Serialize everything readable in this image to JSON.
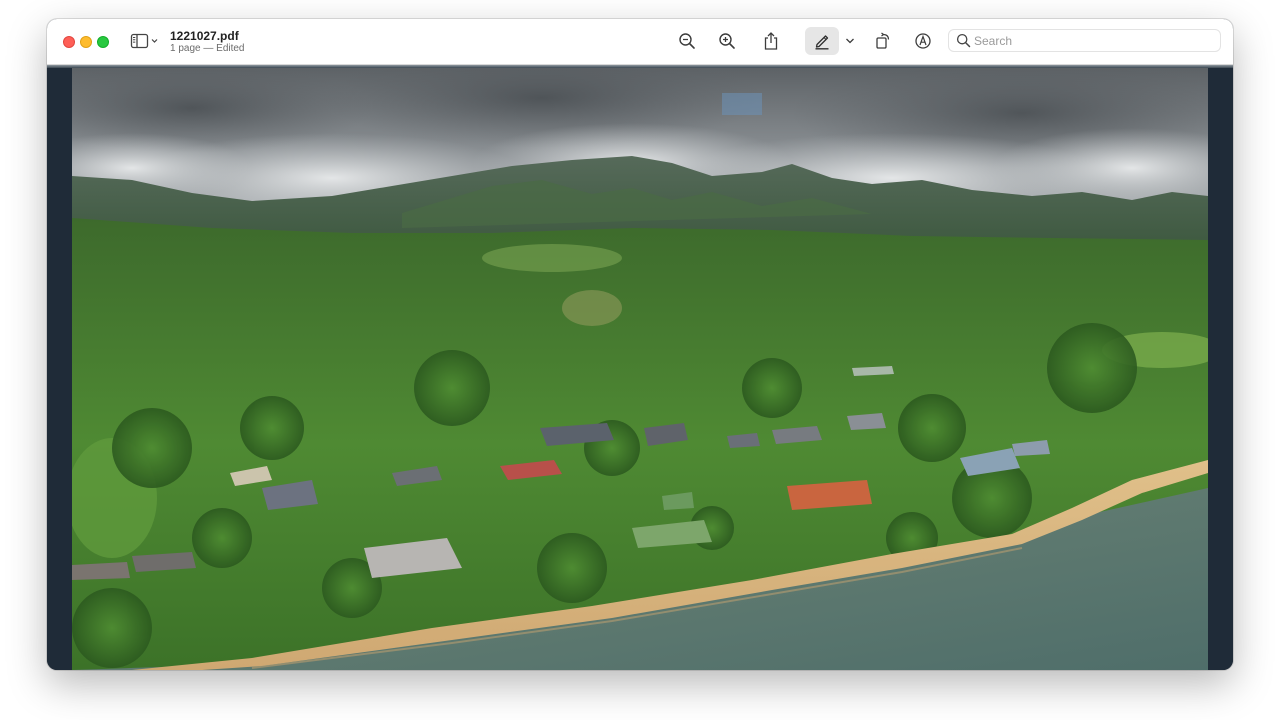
{
  "window": {
    "title": "1221027.pdf",
    "subtitle": "1 page — Edited"
  },
  "toolbar": {
    "sidebar_icon": "sidebar-icon",
    "zoom_out_icon": "zoom-out-icon",
    "zoom_in_icon": "zoom-in-icon",
    "share_icon": "share-icon",
    "markup_icon": "pen-icon",
    "markup_menu_icon": "chevron-down-icon",
    "rotate_icon": "rotate-icon",
    "annotate_icon": "annotate-icon"
  },
  "search": {
    "placeholder": "Search",
    "value": ""
  },
  "document": {
    "image_subject": "aerial-photo"
  },
  "colors": {
    "close": "#fe5f57",
    "minimize": "#febc2e",
    "zoom": "#28c840",
    "viewer_background": "#1f2b38"
  }
}
